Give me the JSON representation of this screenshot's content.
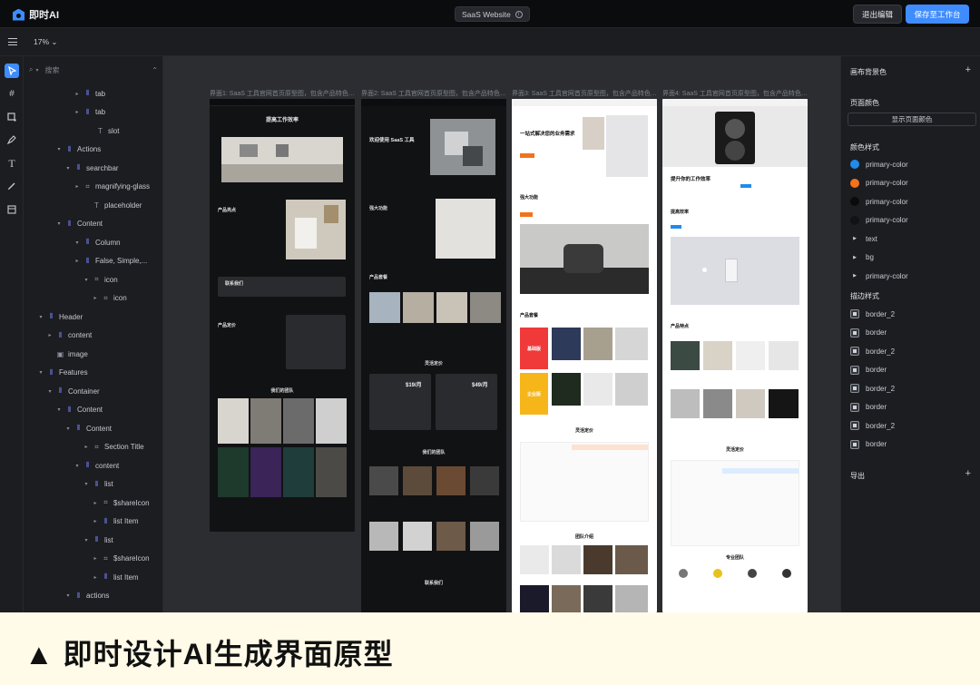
{
  "app": {
    "name": "即时AI",
    "project_title": "SaaS Website",
    "exit_label": "退出编辑",
    "save_label": "保存至工作台"
  },
  "toolbar": {
    "zoom": "17%"
  },
  "layers": {
    "search_placeholder": "搜索",
    "items": [
      {
        "label": "tab",
        "icon": "frame-stack"
      },
      {
        "label": "tab",
        "icon": "frame-stack"
      },
      {
        "label": "slot",
        "icon": "text"
      },
      {
        "label": "Actions",
        "icon": "frame-stack"
      },
      {
        "label": "searchbar",
        "icon": "frame-stack"
      },
      {
        "label": "magnifying-glass",
        "icon": "frame"
      },
      {
        "label": "placeholder",
        "icon": "text"
      },
      {
        "label": "Content",
        "icon": "frame-stack"
      },
      {
        "label": "Column",
        "icon": "frame-stack"
      },
      {
        "label": "False, Simple,...",
        "icon": "frame-stack"
      },
      {
        "label": "icon",
        "icon": "frame"
      },
      {
        "label": "icon",
        "icon": "frame"
      },
      {
        "label": "Header",
        "icon": "frame-stack"
      },
      {
        "label": "content",
        "icon": "frame-stack"
      },
      {
        "label": "image",
        "icon": "image"
      },
      {
        "label": "Features",
        "icon": "frame-stack"
      },
      {
        "label": "Container",
        "icon": "frame-stack"
      },
      {
        "label": "Content",
        "icon": "frame-stack"
      },
      {
        "label": "Content",
        "icon": "frame-stack"
      },
      {
        "label": "Section Title",
        "icon": "frame"
      },
      {
        "label": "content",
        "icon": "frame-stack"
      },
      {
        "label": "list",
        "icon": "frame-stack"
      },
      {
        "label": "$shareIcon",
        "icon": "frame"
      },
      {
        "label": "list Item",
        "icon": "frame-stack"
      },
      {
        "label": "list",
        "icon": "frame-stack"
      },
      {
        "label": "$shareIcon",
        "icon": "frame"
      },
      {
        "label": "list Item",
        "icon": "frame-stack"
      },
      {
        "label": "actions",
        "icon": "frame-stack"
      }
    ]
  },
  "canvas": {
    "frames": [
      {
        "label": "界面1: SaaS 工具官网首页原型图，包含产品特色…"
      },
      {
        "label": "界面2: SaaS 工具官网首页原型图，包含产品特色…"
      },
      {
        "label": "界面3: SaaS 工具官网首页原型图，包含产品特色…"
      },
      {
        "label": "界面4: SaaS 工具官网首页原型图，包含产品特色…"
      }
    ],
    "frame1": {
      "hero_title": "提高工作效率",
      "features_title": "产品亮点",
      "contact_title": "联系我们",
      "pricing_title": "产品定价",
      "team_title": "我们的团队"
    },
    "frame2": {
      "hero_title": "欢迎使用 SaaS 工具",
      "features_title": "强大功能",
      "products_title": "产品套餐",
      "pricing_title": "灵活定价",
      "price_1": "$19/月",
      "price_2": "$49/月",
      "team_title": "我们的团队",
      "contact_title": "联系我们"
    },
    "frame3": {
      "hero_title": "一站式解决您的业务需求",
      "features_title": "强大功能",
      "products_title": "产品套餐",
      "badge_basic": "基础版",
      "badge_enterprise": "企业版",
      "pricing_title": "灵活定价",
      "team_title": "团队介绍"
    },
    "frame4": {
      "hero_title": "提升你的工作效率",
      "efficiency_title": "提高效率",
      "features_title": "产品特点",
      "pricing_title": "灵活定价",
      "team_title": "专业团队"
    }
  },
  "right_panel": {
    "canvas_bg_label": "画布背景色",
    "page_color_label": "页面颜色",
    "show_page_color_label": "显示页面颜色",
    "color_styles_label": "颜色样式",
    "color_styles": [
      {
        "name": "primary-color",
        "color": "#1f8ceb"
      },
      {
        "name": "primary-color",
        "color": "#f2731b"
      },
      {
        "name": "primary-color",
        "color": "#0b0b0c"
      },
      {
        "name": "primary-color",
        "color": "#111214"
      },
      {
        "name": "text",
        "color": ""
      },
      {
        "name": "bg",
        "color": ""
      },
      {
        "name": "primary-color",
        "color": ""
      }
    ],
    "stroke_styles_label": "描边样式",
    "stroke_styles": [
      "border_2",
      "border",
      "border_2",
      "border",
      "border_2",
      "border",
      "border_2",
      "border"
    ],
    "export_label": "导出"
  },
  "caption": {
    "text": "▲ 即时设计AI生成界面原型"
  }
}
